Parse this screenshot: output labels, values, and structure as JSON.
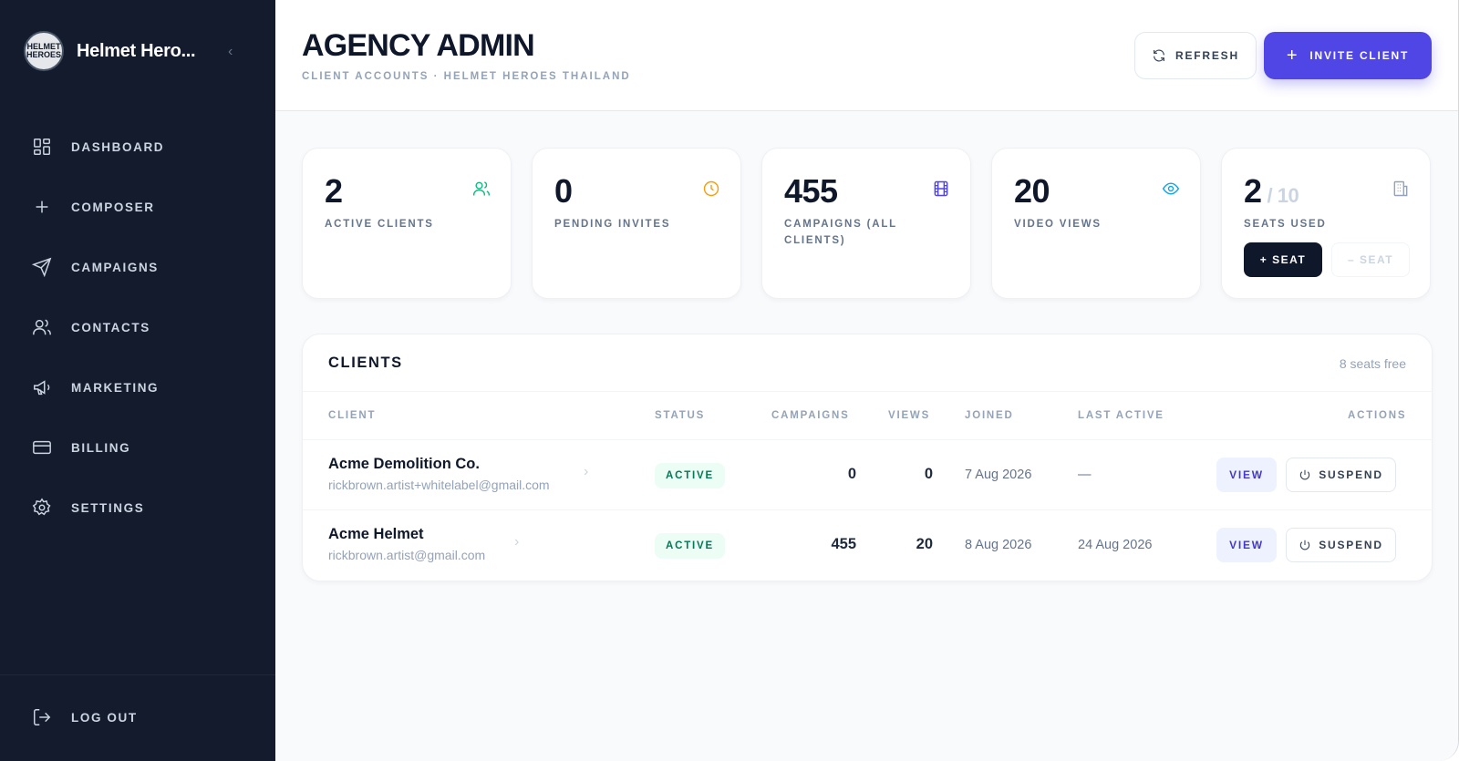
{
  "sidebar": {
    "brand_name": "Helmet Hero...",
    "logo_text": "HELMET HEROES",
    "collapse_icon": "chevron-left-icon",
    "items": [
      {
        "label": "DASHBOARD",
        "icon": "grid-icon"
      },
      {
        "label": "COMPOSER",
        "icon": "plus-icon"
      },
      {
        "label": "CAMPAIGNS",
        "icon": "send-icon"
      },
      {
        "label": "CONTACTS",
        "icon": "users-icon"
      },
      {
        "label": "MARKETING",
        "icon": "megaphone-icon"
      },
      {
        "label": "BILLING",
        "icon": "credit-card-icon"
      },
      {
        "label": "SETTINGS",
        "icon": "gear-icon"
      }
    ],
    "logout_label": "LOG OUT"
  },
  "header": {
    "title": "AGENCY ADMIN",
    "subtitle": "CLIENT ACCOUNTS · HELMET HEROES THAILAND",
    "refresh_label": "REFRESH",
    "invite_label": "INVITE CLIENT"
  },
  "stats": [
    {
      "value": "2",
      "label": "ACTIVE CLIENTS",
      "icon": "users-icon",
      "color": "#10b981"
    },
    {
      "value": "0",
      "label": "PENDING INVITES",
      "icon": "clock-icon",
      "color": "#f59e0b"
    },
    {
      "value": "455",
      "label": "CAMPAIGNS (ALL CLIENTS)",
      "icon": "film-icon",
      "color": "#4f46e5"
    },
    {
      "value": "20",
      "label": "VIDEO VIEWS",
      "icon": "eye-icon",
      "color": "#0ea5e9"
    },
    {
      "value": "2",
      "total": "/ 10",
      "label": "SEATS USED",
      "icon": "building-icon",
      "color": "#94a3b8",
      "add_label": "+ SEAT",
      "remove_label": "– SEAT"
    }
  ],
  "clients": {
    "title": "CLIENTS",
    "seats_free": "8 seats free",
    "columns": [
      "CLIENT",
      "STATUS",
      "CAMPAIGNS",
      "VIEWS",
      "JOINED",
      "LAST ACTIVE",
      "ACTIONS"
    ],
    "rows": [
      {
        "name": "Acme Demolition Co.",
        "email": "rickbrown.artist+whitelabel@gmail.com",
        "status": "ACTIVE",
        "campaigns": "0",
        "views": "0",
        "joined": "7 Aug 2026",
        "last_active": "—",
        "view_label": "VIEW",
        "suspend_label": "SUSPEND"
      },
      {
        "name": "Acme Helmet",
        "email": "rickbrown.artist@gmail.com",
        "status": "ACTIVE",
        "campaigns": "455",
        "views": "20",
        "joined": "8 Aug 2026",
        "last_active": "24 Aug 2026",
        "view_label": "VIEW",
        "suspend_label": "SUSPEND"
      }
    ]
  },
  "colors": {
    "sidebar_bg": "#131b2c",
    "accent": "#4f46e5",
    "status_active": "#047857"
  }
}
